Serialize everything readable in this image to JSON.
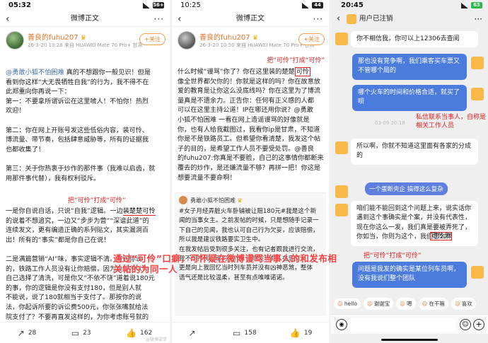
{
  "screens": [
    {
      "status": {
        "time": "05:32",
        "battery": "56+"
      },
      "nav": {
        "title": "微博正文"
      },
      "author": {
        "name": "善良的fuhu207",
        "meta": "26-3-20 13:28  来自 HUAWEI Mate 70 Pro+  甘肃",
        "follow": "+关注"
      },
      "post_lines": [
        "@勇敢小狐不怕困难 真的不想跟你一般见识！但是",
        "看到你这样“大无畏牺牲自我”的行为，我不得不在",
        "此郑重向你再说一下：",
        "",
        "第一：不要拿所谓诉讼在这里唬人！不怕你！热烈",
        "欢迎！",
        "",
        "第二：你在网上开账号发这些低俗内容，装可怜、",
        "博流量、带节奏，包括肆意威胁等，所有的证据我",
        "也都收集了！",
        "",
        "第三：关于你热衷于炒作的那件事（我难以启齿，就",
        "用那件事代替），我有权利驳斥。"
      ],
      "post_lines_b": [
        "一是你自说自话，只说“自我”逻辑。一边",
        "的说着不想追究，一边又“步步为营”“深谙此道”的",
        "连续发文，更有编造正确的系列贴文，其实漏洞百",
        "出！所有的“事实”都是你自己在说！",
        "",
        "二是满篇营销“AI”味，事实逻辑不清。按照你说",
        "的，铁路工作人员没有让你赔偿，因为没钱所以你",
        "自己选择了清洗，可是你又“不依不饶”道着说180元",
        "的事，你的逻辑是你没有支付180，但是别人就",
        "不能说，说了180就相当于支付了。那按你的说",
        "法，你起诉所要的诉讼费500元，你张张嘴就给法",
        "院支付了？不要再直发这样的，为你考虑账号就的"
      ],
      "highlight_phrase": "装楚楚可怜",
      "annotation": "把“可伶”打成“可伶”",
      "actions": {
        "repost": "28",
        "comment": "23",
        "like": "162"
      },
      "watermark": "@微博梁学"
    },
    {
      "status": {
        "time": "10:25",
        "battery": "44"
      },
      "nav": {
        "title": "微博正文"
      },
      "author": {
        "name": "善良的fuhu207",
        "meta": "26-3-20 10:50  来自 HUAWEI Mate 70 Pro+  甘肃",
        "follow": "+关注"
      },
      "post_lines": [
        "什么时候“谩骂”你了？你在这里装的楚楚",
        "像全世界都欠你的！你就是这样的吗？你在故意放",
        "爱的教育是让你这么没底线吗？你在这里为了博流",
        "量真是不遗余力。正告你：任何有正义感的人都",
        "可以在这里主持公道！IP在哪还用你说？@勇敢",
        "小狐不怕困难 一看在网上造谣谩骂的好像就是",
        "你，也有人给我截图过，我看你ip是甘肃，不知道",
        "你是不是铁路员工。但希望你看清楚，我发这个帖",
        "子的目的，是希望工作人员不要受处罚。@善良",
        "的fuhu207:你真是不要脸，自己的这事情你都断来",
        "覆去的炒作，是还嫌流量不够？再拼一把！你这是",
        "想要流量不要命啊！"
      ],
      "redbox_word": "可怜",
      "annotation": "把“可伶”打成“可伶”",
      "quote": {
        "name": "勇敢小狐不怕困难",
        "lines": [
          "#女子月经弄脏火车卧铺被让赔180元#我是这个新",
          "闻的当事女主。之前发帖的时候，只是想随手记录一",
          "下自己的见闻，我也认可自己行为欠妥，应该赔偿，",
          "所以我是建议铁路要实卫生中。",
          "在我发帖后受到很多关注，也有记者跟我进行交流，",
          "我不想打扰大家的工作，但是发现有人在恶意，",
          "更是向上我回忆当时列车员并没有凶神恶煞，整体",
          "语气还是比较温柔，甚至有点唯唯诺诺。"
        ]
      },
      "actions": {
        "repost": "",
        "comment": "158",
        "like": "19"
      }
    },
    {
      "status": {
        "time": "20:45",
        "battery": "63"
      },
      "chat": {
        "title": "用户已注销",
        "messages": [
          "你不相信我，你可以上12306去查阅",
          "那也没有竞争啊，我们乘客买车票又不管哪个局的",
          "哪个火车的时间和价格合适，就买了呗",
          "所以啊，你就不知道这里面有各家的分成的",
          "咱们能不能回到这个问题上来，说实话你遇到这个事确实是个案，并没有代表性，现在你这么一发，我们真是要被弄死了，你如当，你则为这个，我们怎么样",
          "问题是我发的确实是某位列车员啊，没有我说们整个团队"
        ],
        "timestamp": "03-09 20:18",
        "sticker": "一个蛋断央企 搞得这么复杂",
        "redbox_word": "可怜你",
        "annotation_top": "私信联系当事人，自称是相关工作人员",
        "annotation_bottom": "把“可伶”打成“可伶”",
        "quick_replies": [
          "hello",
          "谢谢宝",
          "嗯",
          "在干嘛",
          "喜欢"
        ]
      }
    }
  ],
  "overlay_caption": "通过“可伶”口癖，可怀疑在微博谩骂当事人的和发布相关帖的为同一人"
}
